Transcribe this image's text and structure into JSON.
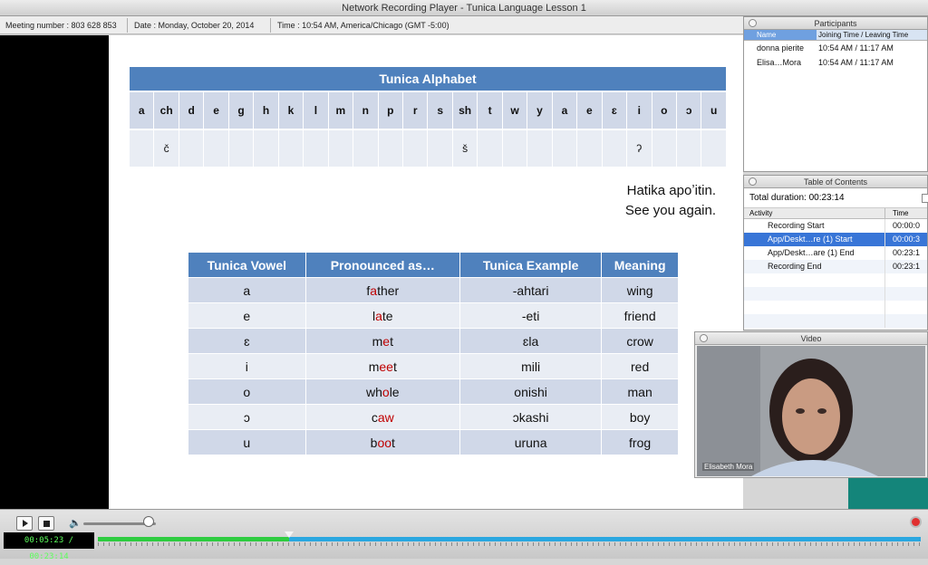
{
  "window": {
    "title": "Network Recording Player - Tunica Language Lesson 1"
  },
  "info": {
    "meeting": "Meeting number : 803 628 853",
    "date": "Date : Monday, October 20, 2014",
    "time": "Time : 10:54 AM, America/Chicago (GMT -5:00)"
  },
  "slide": {
    "alphabet_title": "Tunica Alphabet",
    "letters": [
      "a",
      "ch",
      "d",
      "e",
      "g",
      "h",
      "k",
      "l",
      "m",
      "n",
      "p",
      "r",
      "s",
      "sh",
      "t",
      "w",
      "y",
      "a",
      "e",
      "ɛ",
      "i",
      "o",
      "ɔ",
      "u"
    ],
    "alternates": [
      "",
      "č",
      "",
      "",
      "",
      "",
      "",
      "",
      "",
      "",
      "",
      "",
      "",
      "š",
      "",
      "",
      "",
      "",
      "",
      "",
      "ʔ",
      "",
      "",
      ""
    ],
    "farewell_line1": "Hatika apoʼitin.",
    "farewell_line2": "See you again.",
    "vowel_headers": [
      "Tunica Vowel",
      "Pronounced as…",
      "Tunica Example",
      "Meaning"
    ],
    "vowels": [
      {
        "vowel": "a",
        "pre": "f",
        "hl": "a",
        "post": "ther",
        "example": "-ahtari",
        "meaning": "wing"
      },
      {
        "vowel": "e",
        "pre": "l",
        "hl": "a",
        "post": "te",
        "example": "-eti",
        "meaning": "friend"
      },
      {
        "vowel": "ɛ",
        "pre": "m",
        "hl": "e",
        "post": "t",
        "example": "ɛla",
        "meaning": "crow"
      },
      {
        "vowel": "i",
        "pre": "m",
        "hl": "ee",
        "post": "t",
        "example": "mili",
        "meaning": "red"
      },
      {
        "vowel": "o",
        "pre": "wh",
        "hl": "o",
        "post": "le",
        "example": "onishi",
        "meaning": "man"
      },
      {
        "vowel": "ɔ",
        "pre": "c",
        "hl": "aw",
        "post": "",
        "example": "ɔkashi",
        "meaning": "boy"
      },
      {
        "vowel": "u",
        "pre": "b",
        "hl": "oo",
        "post": "t",
        "example": "uruna",
        "meaning": "frog"
      }
    ]
  },
  "participants": {
    "title": "Participants",
    "col_name": "Name",
    "col_time": "Joining Time / Leaving Time",
    "rows": [
      {
        "name": "donna pierite",
        "time": "10:54 AM / 11:17 AM"
      },
      {
        "name": "Elisa…Mora",
        "time": "10:54 AM / 11:17 AM"
      }
    ]
  },
  "toc": {
    "title": "Table of Contents",
    "total": "Total duration: 00:23:14",
    "col_activity": "Activity",
    "col_time": "Time",
    "rows": [
      {
        "activity": "Recording Start",
        "time": "00:00:0"
      },
      {
        "activity": "App/Deskt…re (1) Start",
        "time": "00:00:3"
      },
      {
        "activity": "App/Deskt…are (1) End",
        "time": "00:23:1"
      },
      {
        "activity": "Recording End",
        "time": "00:23:1"
      }
    ]
  },
  "video": {
    "title": "Video",
    "name": "Elisabeth Mora"
  },
  "controls": {
    "time": "00:05:23 / 00:23:14",
    "progress": 0.232,
    "volume": 0.9,
    "volume_icon": "speaker-icon"
  }
}
